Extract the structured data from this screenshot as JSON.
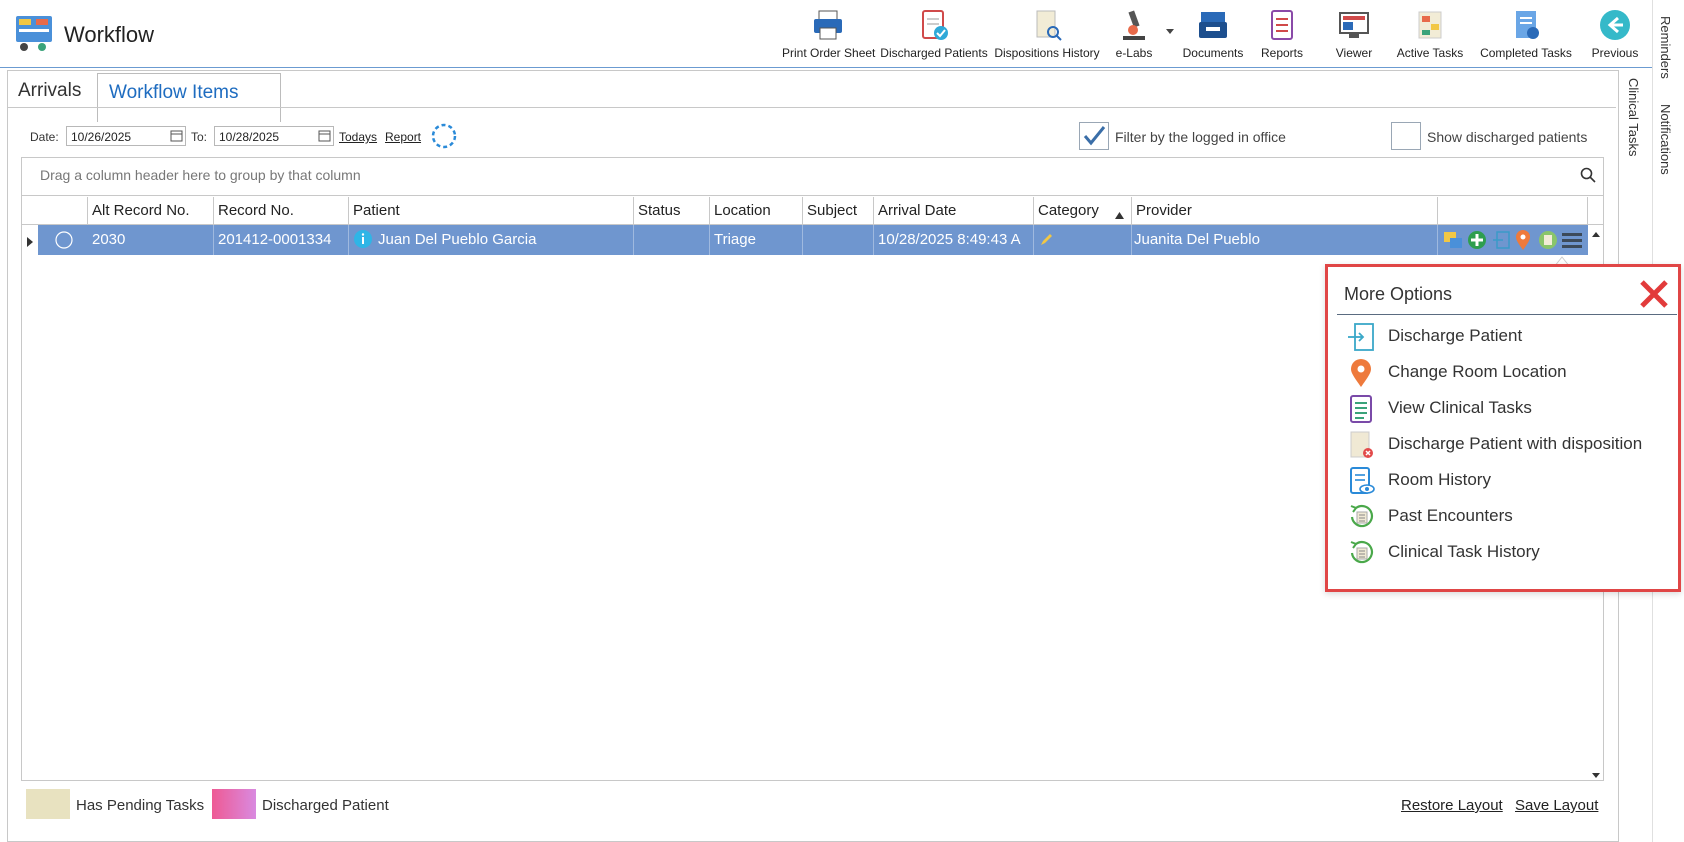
{
  "app": {
    "title": "Workflow"
  },
  "toolbar": {
    "print_order_sheet": "Print Order Sheet",
    "discharged_patients": "Discharged Patients",
    "dispositions_history": "Dispositions History",
    "e_labs": "e-Labs",
    "documents": "Documents",
    "reports": "Reports",
    "viewer": "Viewer",
    "active_tasks": "Active Tasks",
    "completed_tasks": "Completed Tasks",
    "previous": "Previous"
  },
  "side_tabs": {
    "reminders": "Reminders",
    "notifications": "Notifications",
    "clinical_tasks": "Clinical Tasks"
  },
  "tabs": {
    "arrivals": "Arrivals",
    "workflow_items": "Workflow Items"
  },
  "filters": {
    "date_label": "Date:",
    "date_from": "10/26/2025",
    "to_label": "To:",
    "date_to": "10/28/2025",
    "todays_link": "Todays",
    "report_link": "Report",
    "filter_logged_office": "Filter by the logged in office",
    "filter_logged_office_checked": true,
    "show_discharged": "Show discharged patients",
    "show_discharged_checked": false
  },
  "grid": {
    "group_hint": "Drag a column header here to group by that column",
    "columns": [
      "Alt Record No.",
      "Record No.",
      "Patient",
      "Status",
      "Location",
      "Subject",
      "Arrival Date",
      "Category",
      "Provider"
    ],
    "rows": [
      {
        "alt_record": "2030",
        "record": "201412-0001334",
        "patient": "Juan Del Pueblo Garcia",
        "status": "",
        "location": "Triage",
        "subject": "",
        "arrival_date": "10/28/2025 8:49:43 A",
        "category": "",
        "provider": "Juanita Del Pueblo"
      }
    ]
  },
  "more_options": {
    "title": "More Options",
    "items": [
      {
        "label": "Discharge Patient",
        "icon": "discharge-icon"
      },
      {
        "label": "Change Room Location",
        "icon": "location-pin-icon"
      },
      {
        "label": "View Clinical Tasks",
        "icon": "clipboard-icon"
      },
      {
        "label": "Discharge Patient with disposition",
        "icon": "document-x-icon"
      },
      {
        "label": "Room History",
        "icon": "history-doc-icon"
      },
      {
        "label": "Past Encounters",
        "icon": "refresh-doc-icon"
      },
      {
        "label": "Clinical Task History",
        "icon": "refresh-doc-icon"
      }
    ]
  },
  "legend": {
    "pending": "Has Pending Tasks",
    "discharged": "Discharged Patient"
  },
  "footer": {
    "restore_layout": "Restore Layout",
    "save_layout": "Save Layout"
  },
  "colors": {
    "accent": "#1e6cc0",
    "selected_row": "#6f96cf",
    "popup_border": "#e04646",
    "pending": "#e8e2c0",
    "discharged": "#e66aa6"
  }
}
